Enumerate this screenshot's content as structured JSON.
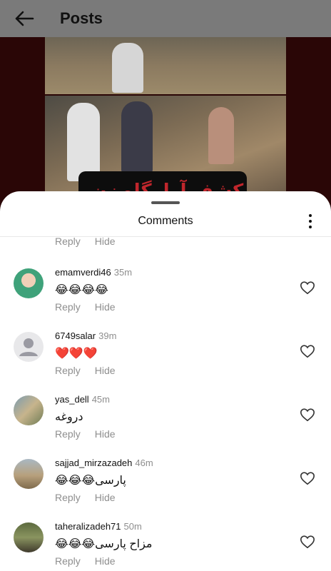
{
  "header": {
    "title": "Posts",
    "back_icon": "arrow-left-icon"
  },
  "post": {
    "banner_text": "کشف آرامگاه زن"
  },
  "sheet": {
    "title": "Comments",
    "menu_icon": "more-vertical-icon"
  },
  "partial_comment": {
    "reply_label": "Reply",
    "hide_label": "Hide"
  },
  "comments": [
    {
      "user": "emamverdi46",
      "time": "35m",
      "text": "😂😂😂😂",
      "reply_label": "Reply",
      "hide_label": "Hide"
    },
    {
      "user": "6749salar",
      "time": "39m",
      "text": "❤️❤️❤️",
      "reply_label": "Reply",
      "hide_label": "Hide"
    },
    {
      "user": "yas_dell",
      "time": "45m",
      "text": "دروغه",
      "reply_label": "Reply",
      "hide_label": "Hide"
    },
    {
      "user": "sajjad_mirzazadeh",
      "time": "46m",
      "text": "پارسی😂😂😂",
      "reply_label": "Reply",
      "hide_label": "Hide"
    },
    {
      "user": "taheralizadeh71",
      "time": "50m",
      "text": "مزاح پارسی😂😂😂",
      "reply_label": "Reply",
      "hide_label": "Hide"
    }
  ],
  "colors": {
    "accent_text": "#111111",
    "muted_text": "#8e8e8e",
    "sheet_bg": "#ffffff"
  }
}
